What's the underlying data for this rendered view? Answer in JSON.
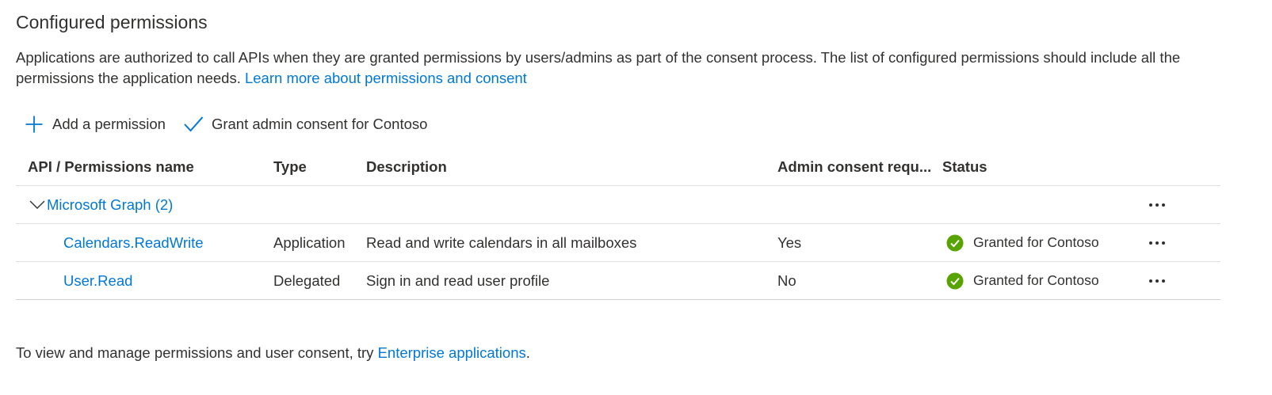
{
  "section": {
    "title": "Configured permissions",
    "description": "Applications are authorized to call APIs when they are granted permissions by users/admins as part of the consent process. The list of configured permissions should include all the permissions the application needs.",
    "learn_more_link": "Learn more about permissions and consent"
  },
  "toolbar": {
    "add_permission": "Add a permission",
    "grant_consent": "Grant admin consent for Contoso",
    "add_icon": "plus-icon",
    "grant_icon": "checkmark-icon"
  },
  "table": {
    "columns": {
      "name": "API / Permissions name",
      "type": "Type",
      "description": "Description",
      "admin": "Admin consent requ...",
      "status": "Status"
    },
    "group": {
      "label": "Microsoft Graph (2)",
      "icon": "chevron-down-icon"
    },
    "rows": [
      {
        "name": "Calendars.ReadWrite",
        "type": "Application",
        "description": "Read and write calendars in all mailboxes",
        "admin": "Yes",
        "status": "Granted for Contoso"
      },
      {
        "name": "User.Read",
        "type": "Delegated",
        "description": "Sign in and read user profile",
        "admin": "No",
        "status": "Granted for Contoso"
      }
    ]
  },
  "footer": {
    "text": "To view and manage permissions and user consent, try ",
    "link": "Enterprise applications",
    "suffix": "."
  },
  "colors": {
    "link": "#0078d4",
    "success": "#57a300",
    "text": "#323130"
  }
}
